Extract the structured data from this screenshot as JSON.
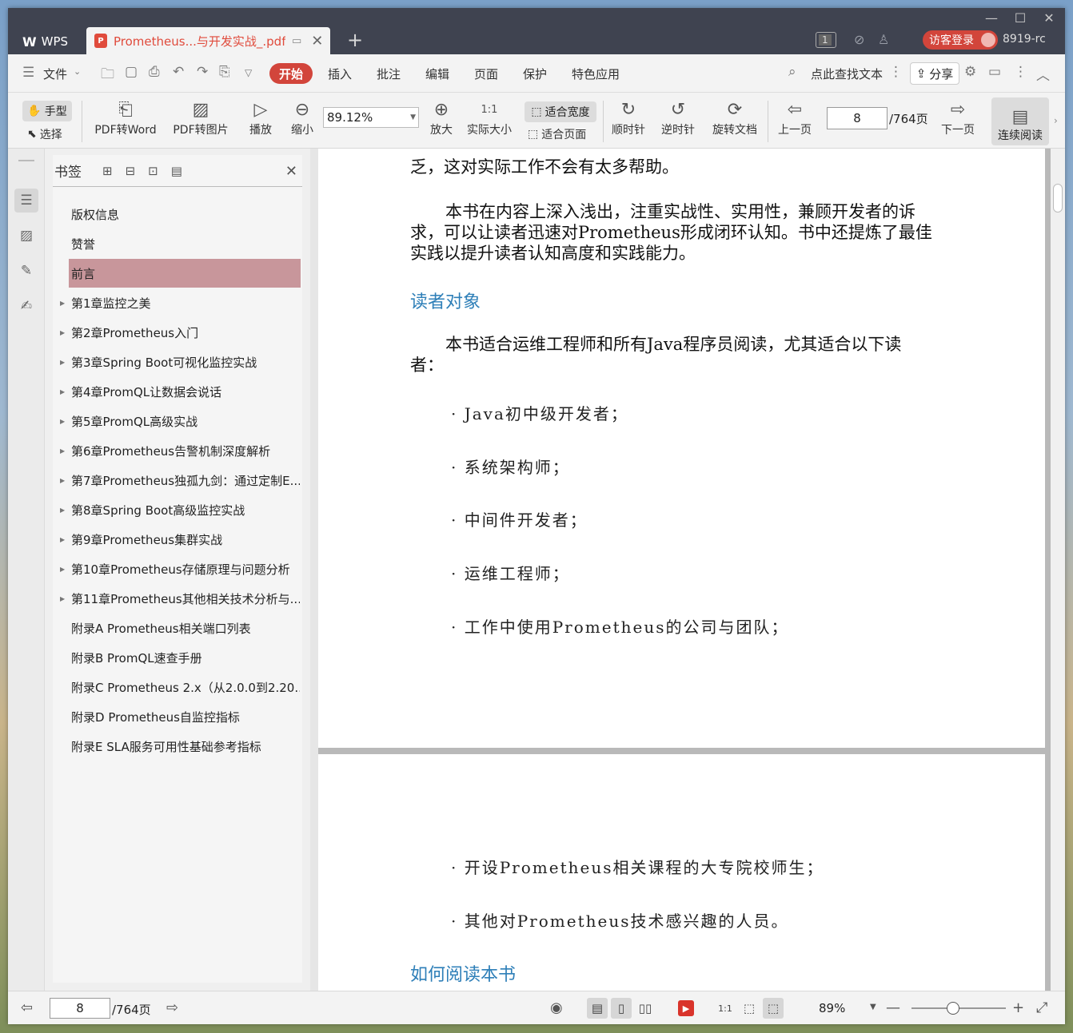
{
  "titlebar": {
    "app_tab": "WPS",
    "doc_tab": "Prometheus...与开发实战_.pdf",
    "window_count": "1",
    "guest_login": "访客登录",
    "user_id": "8919-rc"
  },
  "menubar": {
    "file": "文件",
    "tabs": [
      "开始",
      "插入",
      "批注",
      "编辑",
      "页面",
      "保护",
      "特色应用"
    ],
    "search_text": "点此查找文本",
    "share": "分享"
  },
  "toolbar": {
    "hand": "手型",
    "select": "选择",
    "pdf_to_word": "PDF转Word",
    "pdf_to_image": "PDF转图片",
    "play": "播放",
    "zoom_out": "缩小",
    "zoom_value": "89.12%",
    "zoom_in": "放大",
    "actual_size": "实际大小",
    "fit_width": "适合宽度",
    "fit_page": "适合页面",
    "clockwise": "顺时针",
    "counterclockwise": "逆时针",
    "rotate_doc": "旋转文档",
    "prev_page": "上一页",
    "page_current": "8",
    "page_total": "/764页",
    "next_page": "下一页",
    "continuous_read": "连续阅读"
  },
  "bookmarks": {
    "title": "书签",
    "items": [
      {
        "label": "版权信息",
        "expandable": false,
        "active": false
      },
      {
        "label": "赞誉",
        "expandable": false,
        "active": false
      },
      {
        "label": "前言",
        "expandable": false,
        "active": true
      },
      {
        "label": "第1章监控之美",
        "expandable": true,
        "active": false
      },
      {
        "label": "第2章Prometheus入门",
        "expandable": true,
        "active": false
      },
      {
        "label": "第3章Spring Boot可视化监控实战",
        "expandable": true,
        "active": false
      },
      {
        "label": "第4章PromQL让数据会说话",
        "expandable": true,
        "active": false
      },
      {
        "label": "第5章PromQL高级实战",
        "expandable": true,
        "active": false
      },
      {
        "label": "第6章Prometheus告警机制深度解析",
        "expandable": true,
        "active": false
      },
      {
        "label": "第7章Prometheus独孤九剑：通过定制E...",
        "expandable": true,
        "active": false
      },
      {
        "label": "第8章Spring Boot高级监控实战",
        "expandable": true,
        "active": false
      },
      {
        "label": "第9章Prometheus集群实战",
        "expandable": true,
        "active": false
      },
      {
        "label": "第10章Prometheus存储原理与问题分析",
        "expandable": true,
        "active": false
      },
      {
        "label": "第11章Prometheus其他相关技术分析与...",
        "expandable": true,
        "active": false
      },
      {
        "label": "附录A Prometheus相关端口列表",
        "expandable": false,
        "active": false
      },
      {
        "label": "附录B PromQL速查手册",
        "expandable": false,
        "active": false
      },
      {
        "label": "附录C Prometheus 2.x（从2.0.0到2.20....",
        "expandable": false,
        "active": false
      },
      {
        "label": "附录D Prometheus自监控指标",
        "expandable": false,
        "active": false
      },
      {
        "label": "附录E SLA服务可用性基础参考指标",
        "expandable": false,
        "active": false
      }
    ]
  },
  "document": {
    "page1": {
      "cut_line": "乏，这对实际工作不会有太多帮助。",
      "para1_l1": "本书在内容上深入浅出，注重实战性、实用性，兼顾开发者的诉",
      "para1_l2": "求，可以让读者迅速对Prometheus形成闭环认知。书中还提炼了最佳",
      "para1_l3": "实践以提升读者认知高度和实践能力。",
      "heading": "读者对象",
      "para2_l1": "本书适合运维工程师和所有Java程序员阅读，尤其适合以下读",
      "para2_l2": "者：",
      "bullets": [
        "· Java初中级开发者；",
        "· 系统架构师；",
        "· 中间件开发者；",
        "· 运维工程师；",
        "· 工作中使用Prometheus的公司与团队；"
      ]
    },
    "page2": {
      "bullets": [
        "· 开设Prometheus相关课程的大专院校师生；",
        "· 其他对Prometheus技术感兴趣的人员。"
      ],
      "heading": "如何阅读本书"
    }
  },
  "statusbar": {
    "page_current": "8",
    "page_total": "/764页",
    "zoom": "89%",
    "zoom_fraction": 0.44
  }
}
